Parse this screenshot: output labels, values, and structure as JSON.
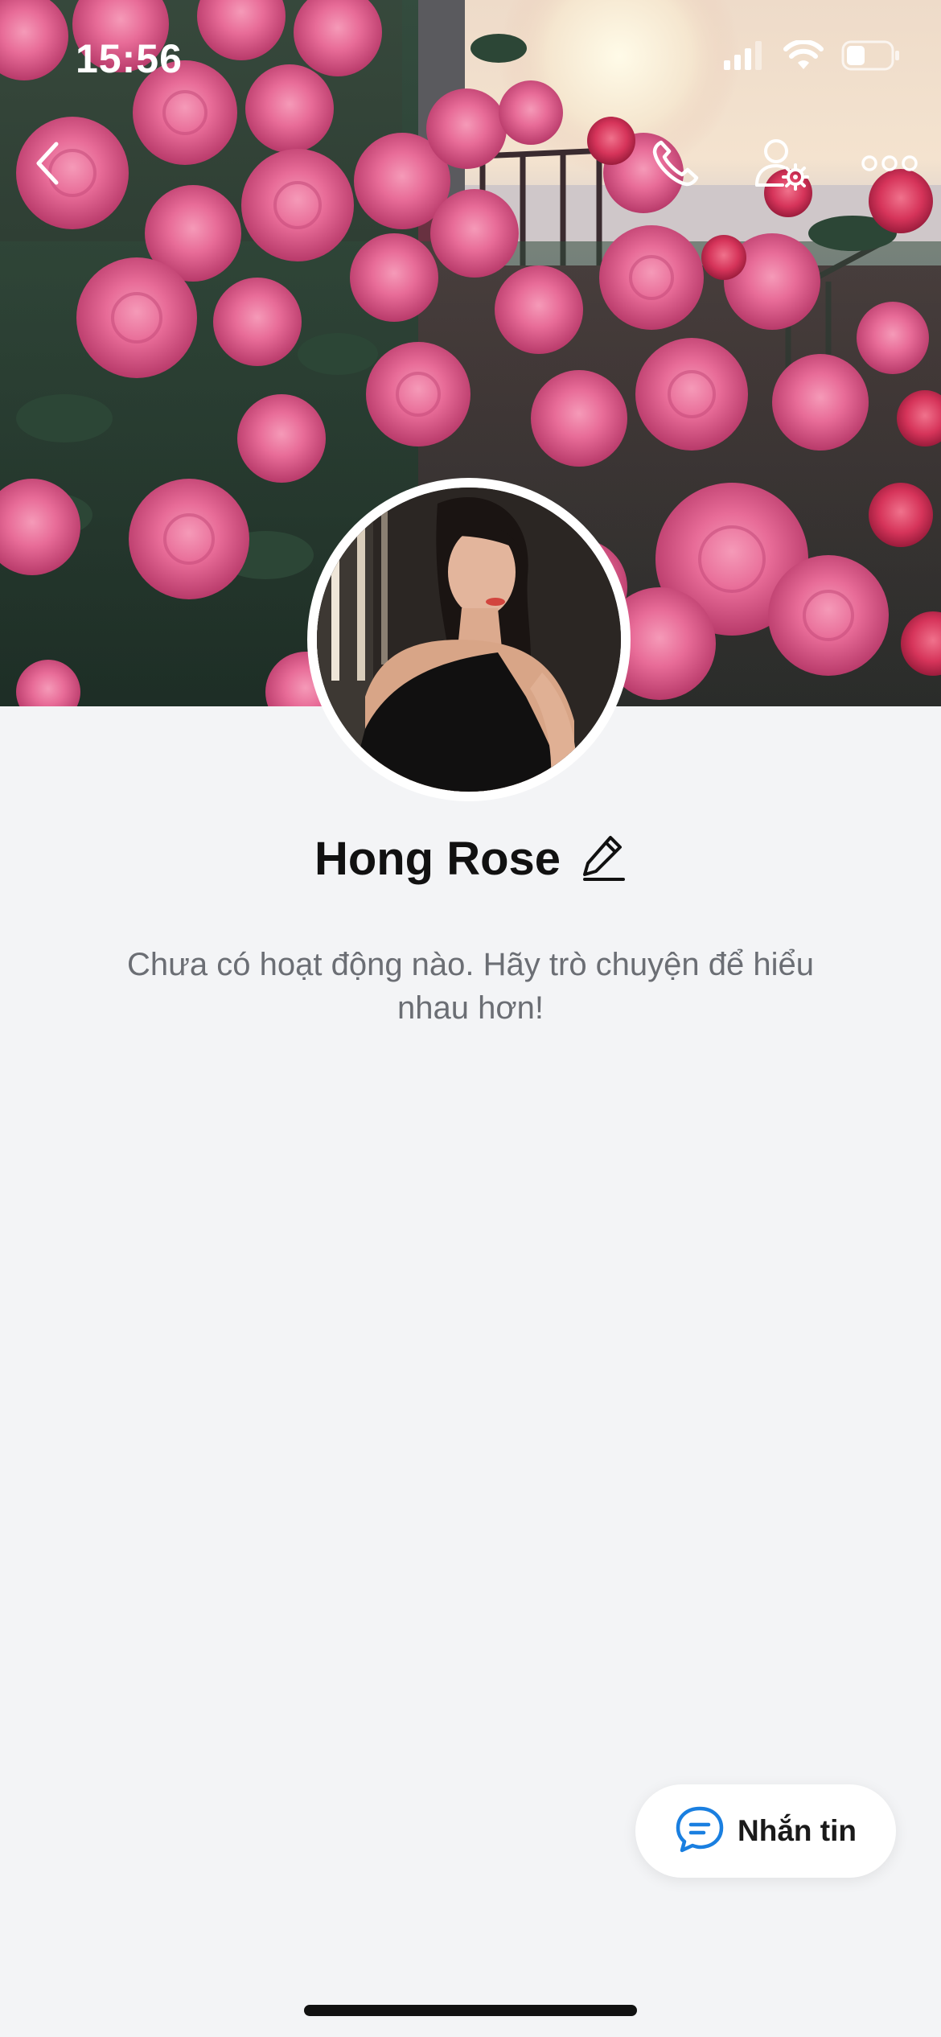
{
  "status_bar": {
    "time": "15:56",
    "icons": [
      "cellular-signal-icon",
      "wifi-icon",
      "battery-icon"
    ]
  },
  "nav": {
    "icons": [
      "back-chevron-icon",
      "phone-icon",
      "user-settings-icon",
      "more-dots-icon"
    ]
  },
  "profile": {
    "name": "Hong Rose",
    "edit_icon": "pencil-icon",
    "empty_message": "Chưa có hoạt động nào. Hãy trò chuyện để hiểu nhau hơn!"
  },
  "message_button": {
    "label": "Nhắn tin",
    "icon": "chat-bubble-icon",
    "accent_color": "#1a7fe0"
  },
  "colors": {
    "background": "#f3f4f6",
    "name_text": "#111111",
    "secondary_text": "#6b6e74"
  }
}
